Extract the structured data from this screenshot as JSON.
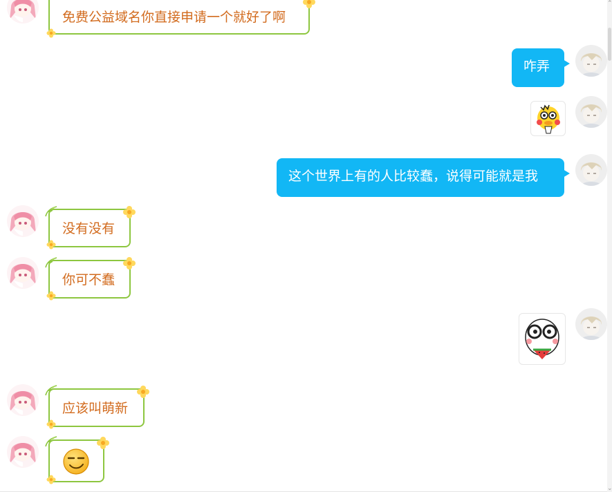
{
  "messages": [
    {
      "side": "left",
      "type": "text",
      "text": "免费公益域名你直接申请一个就好了啊"
    },
    {
      "side": "right",
      "type": "text",
      "text": "咋弄"
    },
    {
      "side": "right",
      "type": "sticker",
      "sticker": "yellow-duck-sticker"
    },
    {
      "side": "right",
      "type": "text",
      "text": "这个世界上有的人比较蠢，说得可能就是我"
    },
    {
      "side": "left",
      "type": "text",
      "text": "没有没有"
    },
    {
      "side": "left",
      "type": "text",
      "text": "你可不蠢"
    },
    {
      "side": "right",
      "type": "sticker",
      "sticker": "watermelon-face-sticker"
    },
    {
      "side": "left",
      "type": "text",
      "text": "应该叫萌新"
    },
    {
      "side": "left",
      "type": "emoji",
      "emoji": "smug-smile-emoji"
    }
  ],
  "colors": {
    "left_border": "#8dc63f",
    "left_text": "#d26b1e",
    "right_bubble": "#12b7f5",
    "right_text": "#ffffff"
  },
  "icons": {
    "left_avatar": "pink-hair-girl-avatar",
    "right_avatar": "blonde-boy-avatar",
    "flower": "yellow-flower-icon"
  }
}
